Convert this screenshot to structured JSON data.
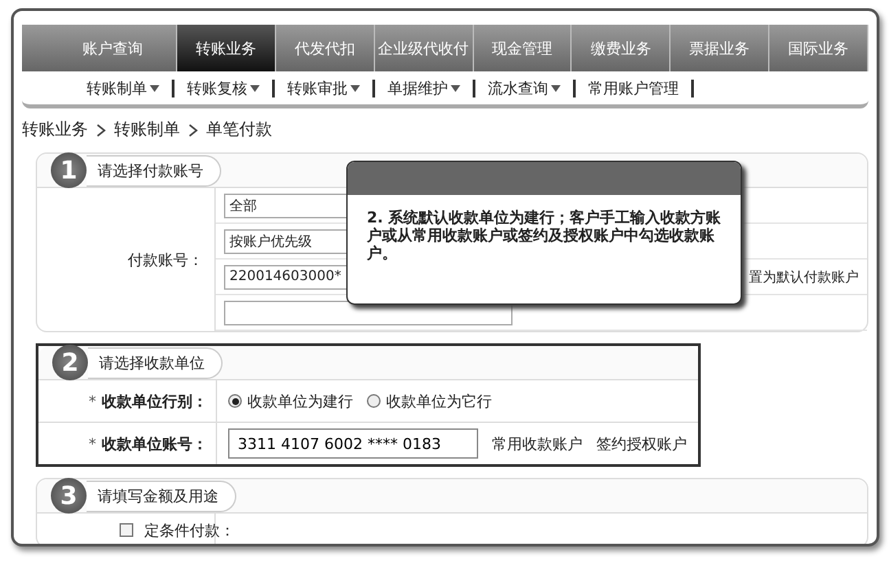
{
  "nav_tabs": [
    {
      "label": "账户查询",
      "selected": false
    },
    {
      "label": "转账业务",
      "selected": true
    },
    {
      "label": "代发代扣",
      "selected": false
    },
    {
      "label": "企业级代收付",
      "selected": false
    },
    {
      "label": "现金管理",
      "selected": false
    },
    {
      "label": "缴费业务",
      "selected": false
    },
    {
      "label": "票据业务",
      "selected": false
    },
    {
      "label": "国际业务",
      "selected": false
    }
  ],
  "sub_menu": [
    {
      "label": "转账制单",
      "dropdown": true
    },
    {
      "label": "转账复核",
      "dropdown": true
    },
    {
      "label": "转账审批",
      "dropdown": true
    },
    {
      "label": "单据维护",
      "dropdown": true
    },
    {
      "label": "流水查询",
      "dropdown": true
    },
    {
      "label": "常用账户管理",
      "dropdown": false
    }
  ],
  "breadcrumb": [
    "转账业务",
    "转账制单",
    "单笔付款"
  ],
  "section_1": {
    "number": "1",
    "title": "请选择付款账号",
    "field_label": "付款账号：",
    "fields": [
      "全部",
      "按账户优先级",
      "220014603000*"
    ],
    "note": "置为默认付款账户"
  },
  "section_2": {
    "number": "2",
    "title": "请选择收款单位",
    "highlighted": true,
    "rows": [
      {
        "kind": "radio",
        "label": "收款单位行别：",
        "required_mark": "*",
        "options": [
          {
            "label": "收款单位为建行",
            "selected": true
          },
          {
            "label": "收款单位为它行",
            "selected": false
          }
        ]
      },
      {
        "kind": "account",
        "label": "收款单位账号：",
        "required_mark": "*",
        "value": "3311 4107 6002 **** 0183",
        "links": [
          "常用收款账户",
          "签约授权账户"
        ]
      }
    ]
  },
  "section_3": {
    "number": "3",
    "title": "请填写金额及用途",
    "checkbox": {
      "label": "定条件付款：",
      "checked": false
    }
  },
  "tooltip": {
    "text": "2. 系统默认收款单位为建行；客户手工输入收款方账户或从常用收款账户或签约及授权账户中勾选收款账户。"
  }
}
